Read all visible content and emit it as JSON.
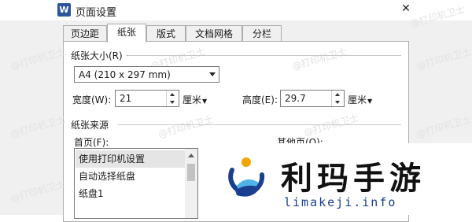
{
  "window": {
    "title": "页面设置",
    "app_icon_letter": "W",
    "close_glyph": "✕"
  },
  "tabs": [
    {
      "label": "页边距",
      "active": false
    },
    {
      "label": "纸张",
      "active": true
    },
    {
      "label": "版式",
      "active": false
    },
    {
      "label": "文档网格",
      "active": false
    },
    {
      "label": "分栏",
      "active": false
    }
  ],
  "paper_size": {
    "group_label": "纸张大小(R)",
    "selected": "A4 (210 x 297 mm)",
    "width_label": "宽度(W):",
    "width_value": "21",
    "width_unit": "厘米",
    "height_label": "高度(E):",
    "height_value": "29.7",
    "height_unit": "厘米"
  },
  "paper_source": {
    "group_label": "纸张来源",
    "first_page_label": "首页(F):",
    "first_page_options": [
      "使用打印机设置",
      "自动选择纸盘",
      "纸盘1"
    ],
    "selected_index": 0,
    "other_pages_label": "其他页(O):"
  },
  "watermark_text": "@打印机卫士",
  "overlay_brand": {
    "name": "利玛手游",
    "url": "limakeji.info",
    "colors": {
      "primary": "#1a3f8f",
      "accent": "#f2a500",
      "light": "#4fb3e8"
    }
  }
}
